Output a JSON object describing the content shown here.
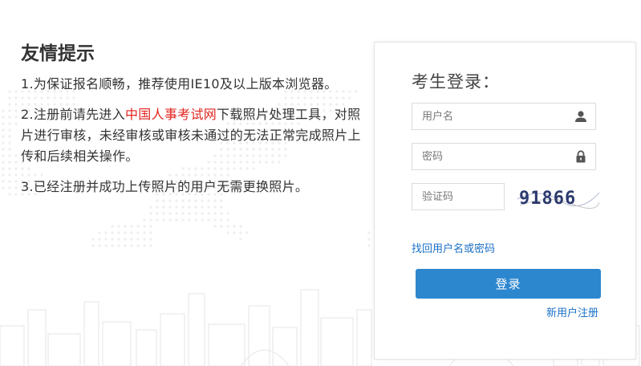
{
  "tips": {
    "title": "友情提示",
    "item1": "1.为保证报名顺畅，推荐使用IE10及以上版本浏览器。",
    "item2_before": "2.注册前请先进入",
    "item2_link": "中国人事考试网",
    "item2_after": "下载照片处理工具，对照片进行审核，未经审核或审核未通过的无法正常完成照片上传和后续相关操作。",
    "item3": "3.已经注册并成功上传照片的用户无需更换照片。"
  },
  "login": {
    "title": "考生登录：",
    "username_placeholder": "用户名",
    "password_placeholder": "密码",
    "captcha_placeholder": "验证码",
    "captcha_text": "91866",
    "forgot_link": "找回用户名或密码",
    "submit_label": "登录",
    "register_link": "新用户注册"
  },
  "colors": {
    "link_red": "#e0241f",
    "link_blue": "#1a70c5",
    "button_blue": "#2d87cf"
  },
  "icons": {
    "username": "user-icon",
    "password": "lock-icon"
  }
}
